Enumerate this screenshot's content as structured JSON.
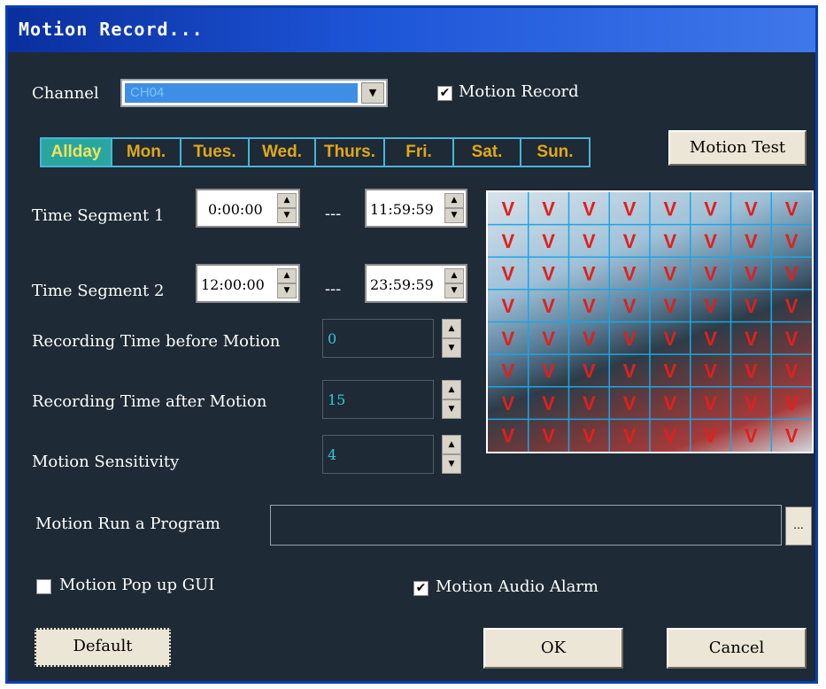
{
  "window": {
    "title": "Motion Record..."
  },
  "channel": {
    "label": "Channel",
    "value": "CH04"
  },
  "motion_record": {
    "label": "Motion Record",
    "checked": true,
    "check_glyph": "✔"
  },
  "days": {
    "items": [
      {
        "label": "Allday",
        "selected": true
      },
      {
        "label": "Mon.",
        "selected": false
      },
      {
        "label": "Tues.",
        "selected": false
      },
      {
        "label": "Wed.",
        "selected": false
      },
      {
        "label": "Thurs.",
        "selected": false
      },
      {
        "label": "Fri.",
        "selected": false
      },
      {
        "label": "Sat.",
        "selected": false
      },
      {
        "label": "Sun.",
        "selected": false
      }
    ]
  },
  "motion_test": {
    "label": "Motion Test"
  },
  "segments": [
    {
      "label": "Time Segment 1",
      "start": "0:00:00",
      "separator": "---",
      "end": "11:59:59"
    },
    {
      "label": "Time Segment 2",
      "start": "12:00:00",
      "separator": "---",
      "end": "23:59:59"
    }
  ],
  "recording_before": {
    "label": "Recording Time before Motion",
    "value": "0"
  },
  "recording_after": {
    "label": "Recording Time after Motion",
    "value": "15"
  },
  "sensitivity": {
    "label": "Motion Sensitivity",
    "value": "4"
  },
  "run_program": {
    "label": "Motion Run a Program",
    "value": "",
    "browse_label": "..."
  },
  "popup_gui": {
    "label": "Motion Pop up GUI",
    "checked": false
  },
  "audio_alarm": {
    "label": "Motion Audio Alarm",
    "checked": true,
    "check_glyph": "✔"
  },
  "motion_grid": {
    "rows": 8,
    "cols": 8,
    "mark": "V",
    "mark_color": "#e0201c",
    "line_color": "#1aa6e8"
  },
  "buttons": {
    "default_label": "Default",
    "ok_label": "OK",
    "cancel_label": "Cancel"
  },
  "icons": {
    "spin_up": "▲",
    "spin_down": "▼",
    "dropdown": "▼"
  },
  "colors": {
    "window_bg": "#1e2a35",
    "title_bar": "#0a2f9e",
    "day_text": "#e0a81a",
    "day_selected_bg": "#2aa6a0",
    "value_text": "#31c7d8"
  }
}
